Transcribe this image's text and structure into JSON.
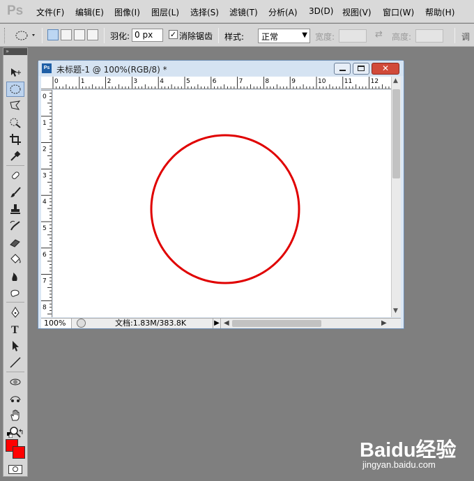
{
  "app": {
    "logo": "Ps"
  },
  "menu": [
    {
      "label": "文件(F)"
    },
    {
      "label": "编辑(E)"
    },
    {
      "label": "图像(I)"
    },
    {
      "label": "图层(L)"
    },
    {
      "label": "选择(S)"
    },
    {
      "label": "滤镜(T)"
    },
    {
      "label": "分析(A)"
    },
    {
      "label": "3D(D)"
    },
    {
      "label": "视图(V)"
    },
    {
      "label": "窗口(W)"
    },
    {
      "label": "帮助(H)"
    }
  ],
  "options": {
    "tool_preset_icon": "ellipse-marquee-icon",
    "feather_label": "羽化:",
    "feather_value": "0 px",
    "antialias_label": "消除锯齿",
    "antialias_checked": true,
    "style_label": "样式:",
    "style_value": "正常",
    "width_label": "宽度:",
    "height_label": "高度:",
    "refine_label": "调"
  },
  "tools": [
    "move-icon",
    "elliptical-marquee-icon",
    "polygonal-lasso-icon",
    "quick-selection-icon",
    "crop-icon",
    "eyedropper-icon",
    "healing-brush-icon",
    "brush-icon",
    "clone-stamp-icon",
    "history-brush-icon",
    "eraser-icon",
    "paint-bucket-icon",
    "burn-icon",
    "sponge-icon",
    "pen-icon",
    "type-icon",
    "path-selection-icon",
    "line-icon",
    "3d-rotate-icon",
    "3d-orbit-icon",
    "hand-icon",
    "zoom-icon"
  ],
  "document": {
    "title": "未标题-1 @ 100%(RGB/8) *",
    "app_icon": "Ps",
    "h_ruler": [
      "0",
      "1",
      "2",
      "3",
      "4",
      "5",
      "6",
      "7",
      "8",
      "9",
      "10",
      "11",
      "12"
    ],
    "v_ruler": [
      "0",
      "1",
      "2",
      "3",
      "4",
      "5",
      "6",
      "7",
      "8"
    ],
    "zoom": "100%",
    "doc_info": "文档:1.83M/383.8K",
    "circle_color": "#e00000"
  },
  "colors": {
    "foreground": "#ff0000",
    "background": "#ff0000"
  },
  "watermark": {
    "logo": "Baidu经验",
    "url": "jingyan.baidu.com"
  }
}
